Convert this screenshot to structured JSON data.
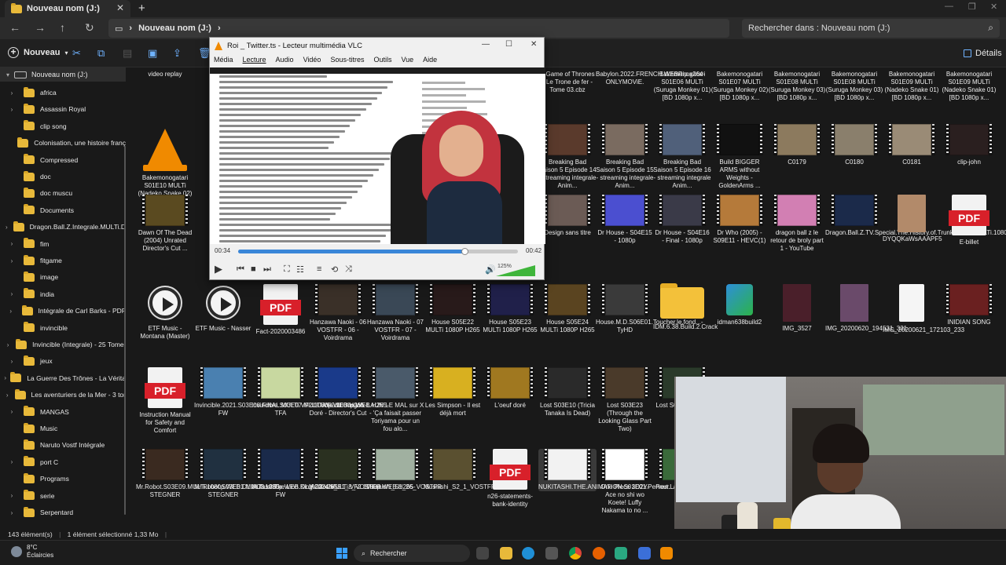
{
  "tabbar": {
    "tab_title": "Nouveau nom (J:)",
    "close": "✕",
    "new_tab": "+"
  },
  "addressbar": {
    "breadcrumb": "Nouveau nom (J:)",
    "search_placeholder": "Rechercher dans : Nouveau nom (J:)"
  },
  "commandbar": {
    "new_label": "Nouveau",
    "details_label": "Détails"
  },
  "sidebar": {
    "root": "Nouveau nom (J:)",
    "items": [
      {
        "label": "africa",
        "expandable": true
      },
      {
        "label": "Assassin Royal",
        "expandable": true
      },
      {
        "label": "clip song",
        "expandable": false
      },
      {
        "label": "Colonisation, une histoire franç",
        "expandable": false
      },
      {
        "label": "Compressed",
        "expandable": false
      },
      {
        "label": "doc",
        "expandable": false
      },
      {
        "label": "doc muscu",
        "expandable": false
      },
      {
        "label": "Documents",
        "expandable": false
      },
      {
        "label": "Dragon.Ball.Z.Integrale.MULTi.D",
        "expandable": true
      },
      {
        "label": "fim",
        "expandable": true
      },
      {
        "label": "fitgame",
        "expandable": true
      },
      {
        "label": "image",
        "expandable": false
      },
      {
        "label": "india",
        "expandable": true
      },
      {
        "label": "Intégrale de Carl Barks - PDF",
        "expandable": true
      },
      {
        "label": "invincible",
        "expandable": false
      },
      {
        "label": "Invincible (Integrale) - 25 Tome:",
        "expandable": true
      },
      {
        "label": "jeux",
        "expandable": true
      },
      {
        "label": "La Guerre Des Trônes - La Vérita",
        "expandable": true
      },
      {
        "label": "Les aventuriers de la Mer - 3 tor",
        "expandable": true
      },
      {
        "label": "MANGAS",
        "expandable": true
      },
      {
        "label": "Music",
        "expandable": false
      },
      {
        "label": "Naruto Vostf Intégrale",
        "expandable": false
      },
      {
        "label": "port C",
        "expandable": true
      },
      {
        "label": "Programs",
        "expandable": false
      },
      {
        "label": "serie",
        "expandable": true
      },
      {
        "label": "Serpentard",
        "expandable": true
      }
    ]
  },
  "files": {
    "row0": [
      {
        "label": "video replay",
        "kind": "text"
      },
      {
        "label": "A Game of Thrones - Le Trone de fer - Tome 03.cbz",
        "kind": "text"
      },
      {
        "label": "Babylon.2022.FRENCH.WEBRip.x264-ONLYMOViE.",
        "kind": "text"
      },
      {
        "label": "Bakemonogatari S01E06 MULTi (Suruga Monkey 01) [BD 1080p x...",
        "kind": "text"
      },
      {
        "label": "Bakemonogatari S01E07 MULTi (Suruga Monkey 02) [BD 1080p x...",
        "kind": "text"
      },
      {
        "label": "Bakemonogatari S01E08 MULTi (Suruga Monkey 03) [BD 1080p x...",
        "kind": "text"
      },
      {
        "label": "Bakemonogatari S01E08 MULTi (Suruga Monkey 03) [BD 1080p x...",
        "kind": "text"
      },
      {
        "label": "Bakemonogatari S01E09 MULTi (Nadeko Snake 01) [BD 1080p x...",
        "kind": "text"
      },
      {
        "label": "Bakemonogatari S01E09 MULTi (Nadeko Snake 01) [BD 1080p x...",
        "kind": "text"
      }
    ],
    "row1": [
      {
        "label": "Bakemonogatari S01E10 MULTi (Nadeko Snake 02) [BD 1080p x...",
        "kind": "vlc"
      },
      {
        "label": "Breaking Bad Saison 5 Episode 14 - streaming integrale Anim...",
        "kind": "video",
        "color": "#5a3a2c"
      },
      {
        "label": "Breaking Bad Saison 5 Episode 15 - streaming integrale Anim...",
        "kind": "video",
        "color": "#7a6b60"
      },
      {
        "label": "Breaking Bad Saison 5 Episode 16 - streaming integrale Anim...",
        "kind": "video",
        "color": "#50607a"
      },
      {
        "label": "Build BIGGER ARMS without Weights - GoldenArms ...",
        "kind": "video",
        "color": "#111111"
      },
      {
        "label": "C0179",
        "kind": "video",
        "color": "#8c7a5e"
      },
      {
        "label": "C0180",
        "kind": "video",
        "color": "#8a7f6c"
      },
      {
        "label": "C0181",
        "kind": "video",
        "color": "#9a8b76"
      },
      {
        "label": "clip-john",
        "kind": "video",
        "color": "#2a1f1f"
      }
    ],
    "row2": [
      {
        "label": "Dawn Of The Dead (2004) Unrated Director's Cut ...",
        "kind": "video",
        "color": "#5a4a20"
      },
      {
        "label": "Design sans titre",
        "kind": "video",
        "color": "#6b5b55"
      },
      {
        "label": "Dr House - S04E15 - 1080p",
        "kind": "video",
        "color": "#4b4fd0"
      },
      {
        "label": "Dr House - S04E16 - Final - 1080p",
        "kind": "video",
        "color": "#3a3a48"
      },
      {
        "label": "Dr Who (2005) - S09E11 - HEVC(1)",
        "kind": "video",
        "color": "#b57a3a"
      },
      {
        "label": "dragon ball z le retour de broly part 1 - YouTube",
        "kind": "video",
        "color": "#d27fb3"
      },
      {
        "label": "Dragon.Ball.Z.TV.Special.The.History.of.Trunks.1993.MULTi.1080p.m...",
        "kind": "video",
        "color": "#1b2a4a"
      },
      {
        "label": "DYQQKaWsAAAPF5",
        "kind": "photo",
        "color": "#b28a6a"
      },
      {
        "label": "E-billet",
        "kind": "pdf"
      }
    ],
    "row3": [
      {
        "label": "ETF Music - Montana (Master)",
        "kind": "player"
      },
      {
        "label": "ETF Music - Nasser",
        "kind": "player"
      },
      {
        "label": "Fact-2020003486",
        "kind": "pdf"
      },
      {
        "label": "Hanzawa Naoki - 06 VOSTFR - 06 - Voirdrama",
        "kind": "video",
        "color": "#3a3028"
      },
      {
        "label": "Hanzawa Naoki - 07 VOSTFR - 07 - Voirdrama",
        "kind": "video",
        "color": "#3a4856"
      },
      {
        "label": "House S05E22 MULTi 1080P H265",
        "kind": "video",
        "color": "#281a1a"
      },
      {
        "label": "House S05E23 MULTi 1080P H265",
        "kind": "video",
        "color": "#20204a"
      },
      {
        "label": "House S05E24 MULTi 1080P H265",
        "kind": "video",
        "color": "#5a4420"
      },
      {
        "label": "House.M.D.S06E01.Toucher.le.fond...-TyHD",
        "kind": "video",
        "color": "#3a3a3a"
      },
      {
        "label": "IDM.6.38.Build.2.Crack",
        "kind": "folder"
      },
      {
        "label": "idman638build2",
        "kind": "setup"
      },
      {
        "label": "IMG_3527",
        "kind": "photo",
        "color": "#4a1f2a"
      },
      {
        "label": "IMG_20200620_194531_331",
        "kind": "photo",
        "color": "#6a4a6a"
      },
      {
        "label": "IMG_20200621_172103_233",
        "kind": "blank"
      },
      {
        "label": "INIDIAN SONG",
        "kind": "video",
        "color": "#6a2020"
      }
    ],
    "row4": [
      {
        "label": "Instruction Manual for Safety and Comfort",
        "kind": "pdf"
      },
      {
        "label": "Invincible.2021.S03E08.FiNAL.MULTi.VF2.1080p.WEB.H265-FW",
        "kind": "video",
        "color": "#4a80b0"
      },
      {
        "label": "Invincible.S03E07.MULTi.VF2.1080p.WEB.H265-TFA",
        "kind": "video",
        "color": "#c8d8a0"
      },
      {
        "label": "La Voie du Dragon Doré - Director's Cut",
        "kind": "video",
        "color": "#1a3a8a"
      },
      {
        "label": "LAUN LE MAL sur X - 'Ça faisait passer Toriyama pour un fou alo...",
        "kind": "video",
        "color": "#4a5a6a"
      },
      {
        "label": "Les Simpson - Il est déjà mort",
        "kind": "video",
        "color": "#d8b020"
      },
      {
        "label": "L'oeuf doré",
        "kind": "video",
        "color": "#a07820"
      },
      {
        "label": "Lost S03E10 (Tricia Tanaka Is Dead)",
        "kind": "video",
        "color": "#2a2a2a"
      },
      {
        "label": "Lost S03E23 (Through the Looking Glass Part Two)",
        "kind": "video",
        "color": "#4a3a2a"
      },
      {
        "label": "Lost S03E2... Co...",
        "kind": "video",
        "color": "#2a3a2a"
      }
    ],
    "row5": [
      {
        "label": "Mr.Robot.S03E09.MULTi.1080p.WEB.DL.AC3.x265-STEGNER",
        "kind": "video",
        "color": "#3a2a20"
      },
      {
        "label": "Mr.Robot.S03E01.MULTi.1080p.WEB.DL.AC3.x265-STEGNER",
        "kind": "video",
        "color": "#203040"
      },
      {
        "label": "Mufasa.The.Lion.King.2024.MULTi.VF2.1080p.WEB.H265-FW",
        "kind": "video",
        "color": "#1a2a4a"
      },
      {
        "label": "Mushishi_S1_8_VOSTFR",
        "kind": "video",
        "color": "#2a3020"
      },
      {
        "label": "Mushishi_S1_26_VOSTFR",
        "kind": "video",
        "color": "#a0b0a0"
      },
      {
        "label": "Mushishi_S2_1_VOSTFR",
        "kind": "video",
        "color": "#5a5030"
      },
      {
        "label": "n26-statements-bank-identity",
        "kind": "pdf"
      },
      {
        "label": "NUKITASHI.THE.ANIMATION.S01E01.Pervert.Law.1080p.UNCENS...",
        "kind": "video",
        "color": "#f2f2f2",
        "selected": true
      },
      {
        "label": "One Piece 3D2Y- Ace no shi wo Koete! Luffy Nakama to no ...",
        "kind": "video",
        "color": "#ffffff"
      },
      {
        "label": "Pour... est ir... Pu...",
        "kind": "video",
        "color": "#3a6a3a"
      }
    ]
  },
  "vlc": {
    "title": "Roi _ Twitter.ts - Lecteur multimédia VLC",
    "menu": [
      "Média",
      "Lecture",
      "Audio",
      "Vidéo",
      "Sous-titres",
      "Outils",
      "Vue",
      "Aide"
    ],
    "active_menu": "Lecture",
    "elapsed": "00:34",
    "total": "00:42",
    "progress": 0.81,
    "volume": "125%"
  },
  "statusbar": {
    "count": "143 élément(s)",
    "selection": "1 élément sélectionné  1,33 Mo"
  },
  "taskbar": {
    "temp": "8°C",
    "weather": "Éclaircies",
    "search": "Rechercher"
  },
  "colors": {
    "accent": "#6fb2ff",
    "folder": "#f3c13a",
    "pdf": "#d8202a",
    "vlc_orange": "#f08a00"
  }
}
